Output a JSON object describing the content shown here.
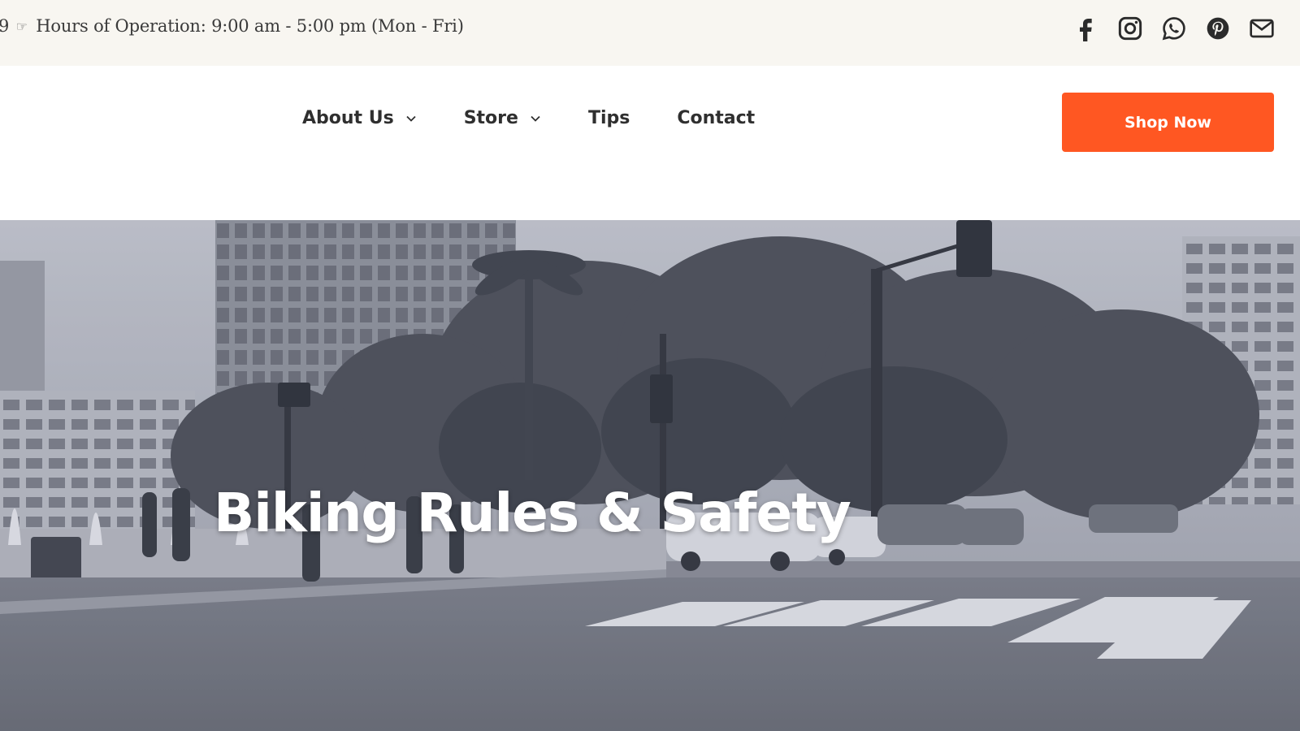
{
  "topbar": {
    "info_prefix": "9",
    "hand_glyph": "☞",
    "hours_text": "Hours of Operation: 9:00 am - 5:00 pm (Mon - Fri)",
    "socials": [
      {
        "name": "facebook-icon"
      },
      {
        "name": "instagram-icon"
      },
      {
        "name": "whatsapp-icon"
      },
      {
        "name": "pinterest-icon"
      },
      {
        "name": "email-icon"
      }
    ]
  },
  "nav": {
    "items": [
      {
        "label": "About Us",
        "has_dropdown": true
      },
      {
        "label": "Store",
        "has_dropdown": true
      },
      {
        "label": "Tips",
        "has_dropdown": false
      },
      {
        "label": "Contact",
        "has_dropdown": false
      }
    ],
    "shop_button": "Shop Now"
  },
  "hero": {
    "title": "Biking Rules & Safety"
  },
  "colors": {
    "accent": "#ff5722",
    "topbar_bg": "#f8f6f1",
    "text": "#2f2f2f"
  }
}
